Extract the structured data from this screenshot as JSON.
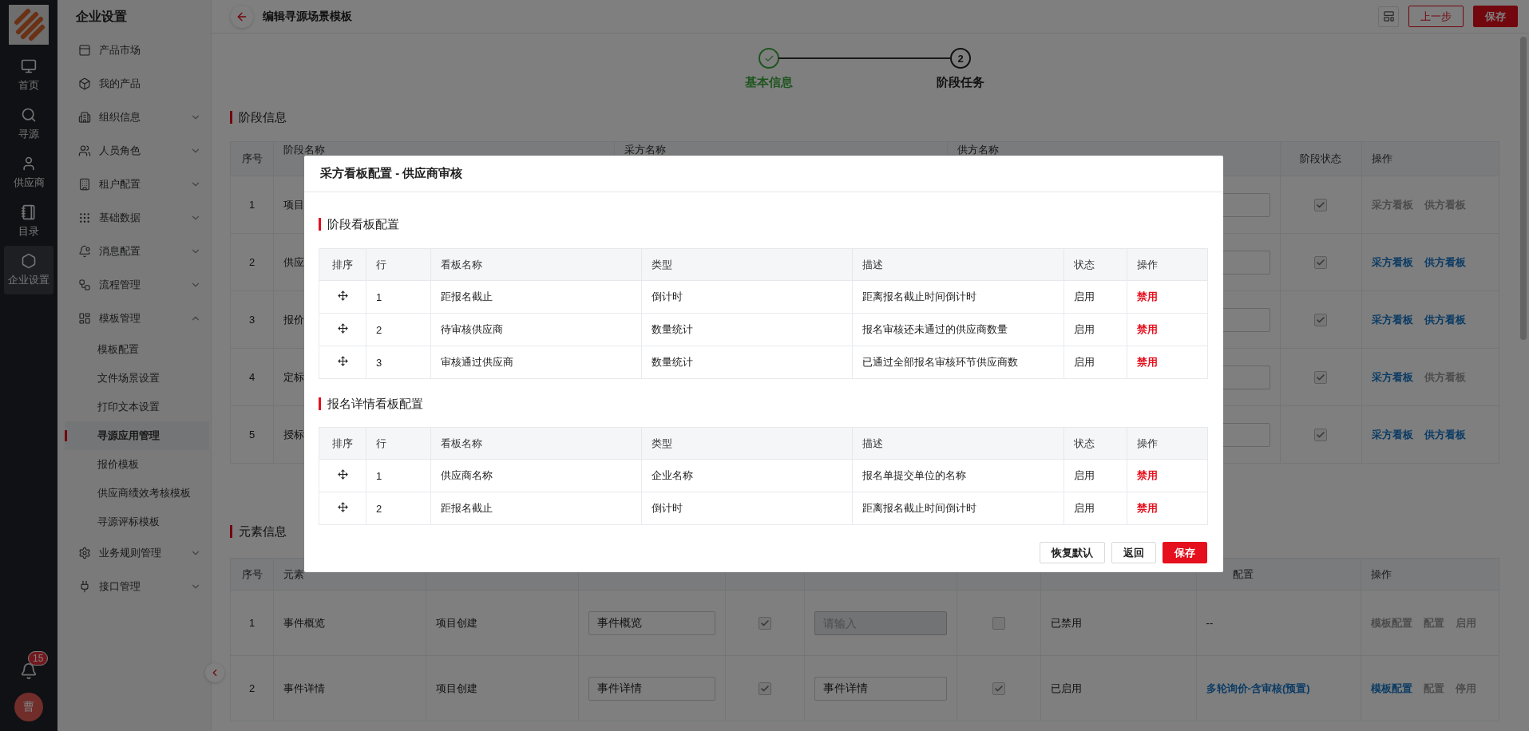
{
  "rail": {
    "items": [
      {
        "label": "首页",
        "selected": false
      },
      {
        "label": "寻源",
        "selected": false
      },
      {
        "label": "供应商",
        "selected": false
      },
      {
        "label": "目录",
        "selected": false
      },
      {
        "label": "企业设置",
        "selected": true
      }
    ],
    "badge": "15",
    "avatar": "曹"
  },
  "sidebar": {
    "title": "企业设置",
    "items": [
      {
        "label": "产品市场",
        "kind": "link"
      },
      {
        "label": "我的产品",
        "kind": "link"
      },
      {
        "label": "组织信息",
        "kind": "group",
        "expanded": false
      },
      {
        "label": "人员角色",
        "kind": "group",
        "expanded": false
      },
      {
        "label": "租户配置",
        "kind": "group",
        "expanded": false
      },
      {
        "label": "基础数据",
        "kind": "group",
        "expanded": false
      },
      {
        "label": "消息配置",
        "kind": "group",
        "expanded": false
      },
      {
        "label": "流程管理",
        "kind": "group",
        "expanded": false
      },
      {
        "label": "模板管理",
        "kind": "group",
        "expanded": true,
        "children": [
          {
            "label": "模板配置",
            "selected": false
          },
          {
            "label": "文件场景设置",
            "selected": false
          },
          {
            "label": "打印文本设置",
            "selected": false
          },
          {
            "label": "寻源应用管理",
            "selected": true
          },
          {
            "label": "报价模板",
            "selected": false
          },
          {
            "label": "供应商绩效考核模板",
            "selected": false
          },
          {
            "label": "寻源评标模板",
            "selected": false
          }
        ]
      },
      {
        "label": "业务规则管理",
        "kind": "group",
        "expanded": false
      },
      {
        "label": "接口管理",
        "kind": "group",
        "expanded": false
      }
    ]
  },
  "header": {
    "title": "编辑寻源场景模板",
    "buttons": [
      {
        "label": "上一步",
        "kind": "outline"
      },
      {
        "label": "保存",
        "kind": "primary"
      }
    ]
  },
  "steps": [
    {
      "label": "基本信息",
      "done": true
    },
    {
      "number": "2",
      "label": "阶段任务",
      "done": false
    }
  ],
  "stage_section": {
    "title": "阶段信息",
    "columns": [
      "序号",
      "阶段名称",
      "采方名称",
      "供方名称",
      "阶段状态",
      "操作"
    ],
    "rows": [
      {
        "index": "1",
        "name": "项目",
        "checked": true,
        "actions": [
          {
            "label": "采方看板",
            "enabled": false
          },
          {
            "label": "供方看板",
            "enabled": false
          }
        ]
      },
      {
        "index": "2",
        "name": "供应",
        "checked": true,
        "actions": [
          {
            "label": "采方看板",
            "enabled": true
          },
          {
            "label": "供方看板",
            "enabled": true
          }
        ]
      },
      {
        "index": "3",
        "name": "报价",
        "checked": true,
        "actions": [
          {
            "label": "采方看板",
            "enabled": true
          },
          {
            "label": "供方看板",
            "enabled": true
          }
        ]
      },
      {
        "index": "4",
        "name": "定标",
        "checked": true,
        "actions": [
          {
            "label": "采方看板",
            "enabled": true
          },
          {
            "label": "供方看板",
            "enabled": false
          }
        ]
      },
      {
        "index": "5",
        "name": "授标",
        "checked": true,
        "actions": [
          {
            "label": "采方看板",
            "enabled": true
          },
          {
            "label": "供方看板",
            "enabled": true
          }
        ]
      }
    ]
  },
  "element_section": {
    "title": "元素信息",
    "columns": {
      "index": "序号",
      "name": "元素",
      "config": "配置",
      "actions": "操作"
    },
    "rows": [
      {
        "index": "1",
        "name": "事件概览",
        "stage": "项目创建",
        "buyer_input": {
          "value": "事件概览",
          "disabled": false
        },
        "buyer_checked": true,
        "supplier_input": {
          "placeholder": "请输入",
          "disabled": true
        },
        "supplier_checked": false,
        "status": "已禁用",
        "config": {
          "kind": "text",
          "text": "--"
        },
        "actions": [
          {
            "label": "模板配置",
            "enabled": false
          },
          {
            "label": "配置",
            "enabled": false
          },
          {
            "label": "启用",
            "enabled": false
          }
        ]
      },
      {
        "index": "2",
        "name": "事件详情",
        "stage": "项目创建",
        "buyer_input": {
          "value": "事件详情",
          "disabled": false
        },
        "buyer_checked": true,
        "supplier_input": {
          "value": "事件详情",
          "disabled": false
        },
        "supplier_checked": true,
        "status": "已启用",
        "config": {
          "kind": "link",
          "text": "多轮询价-含审核(预置)"
        },
        "actions": [
          {
            "label": "模板配置",
            "enabled": true
          },
          {
            "label": "配置",
            "enabled": false
          },
          {
            "label": "停用",
            "enabled": false
          }
        ]
      }
    ]
  },
  "modal": {
    "title": "采方看板配置 - 供应商审核",
    "sections": [
      {
        "title": "阶段看板配置",
        "columns": [
          "排序",
          "行",
          "看板名称",
          "类型",
          "描述",
          "状态",
          "操作"
        ],
        "rows": [
          {
            "row": "1",
            "name": "距报名截止",
            "type": "倒计时",
            "description": "距离报名截止时间倒计时",
            "status": "启用",
            "action": "禁用"
          },
          {
            "row": "2",
            "name": "待审核供应商",
            "type": "数量统计",
            "description": "报名审核还未通过的供应商数量",
            "status": "启用",
            "action": "禁用"
          },
          {
            "row": "3",
            "name": "审核通过供应商",
            "type": "数量统计",
            "description": "已通过全部报名审核环节供应商数",
            "status": "启用",
            "action": "禁用"
          }
        ]
      },
      {
        "title": "报名详情看板配置",
        "columns": [
          "排序",
          "行",
          "看板名称",
          "类型",
          "描述",
          "状态",
          "操作"
        ],
        "rows": [
          {
            "row": "1",
            "name": "供应商名称",
            "type": "企业名称",
            "description": "报名单提交单位的名称",
            "status": "启用",
            "action": "禁用"
          },
          {
            "row": "2",
            "name": "距报名截止",
            "type": "倒计时",
            "description": "距离报名截止时间倒计时",
            "status": "启用",
            "action": "禁用"
          }
        ]
      }
    ],
    "buttons": [
      {
        "label": "恢复默认",
        "kind": "default"
      },
      {
        "label": "返回",
        "kind": "default"
      },
      {
        "label": "保存",
        "kind": "primary"
      }
    ]
  }
}
